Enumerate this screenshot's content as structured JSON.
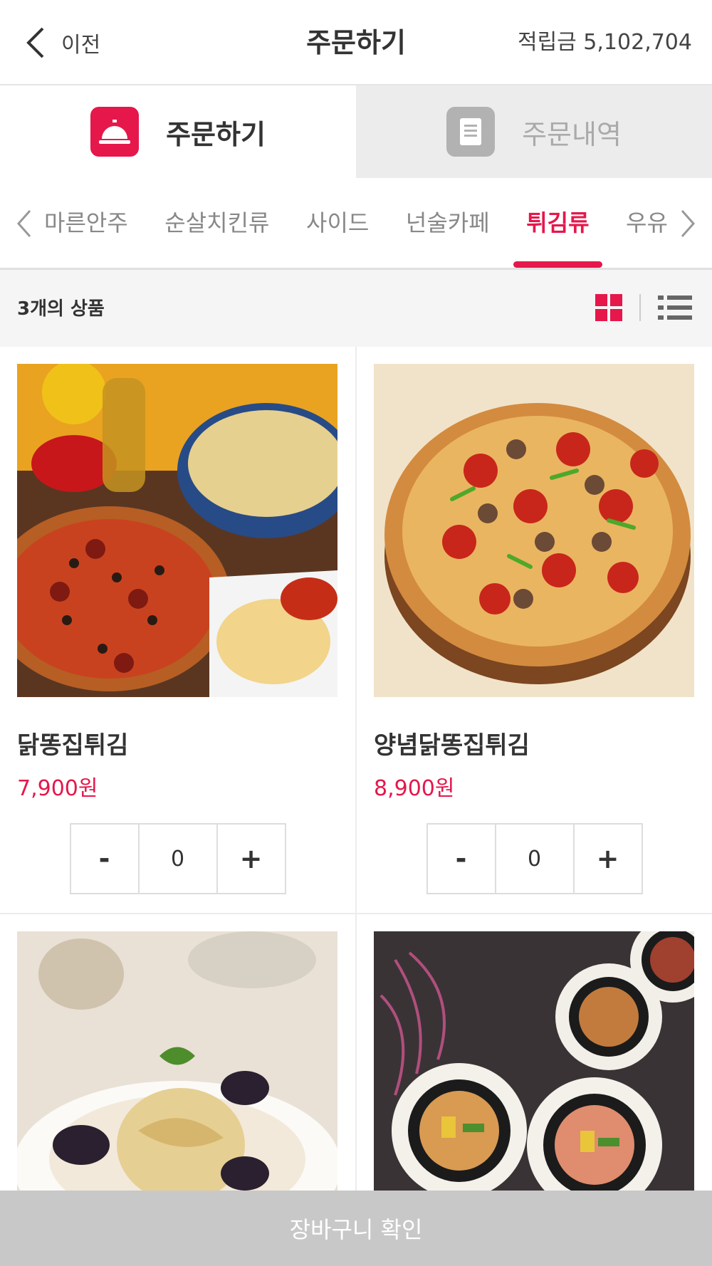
{
  "header": {
    "back_label": "이전",
    "title": "주문하기",
    "points": "적립금 5,102,704"
  },
  "tabs": [
    {
      "label": "주문하기",
      "icon": "service-bell-icon",
      "active": true
    },
    {
      "label": "주문내역",
      "icon": "receipt-icon",
      "active": false
    }
  ],
  "categories": [
    {
      "label": "마른안주",
      "active": false
    },
    {
      "label": "순살치킨류",
      "active": false
    },
    {
      "label": "사이드",
      "active": false
    },
    {
      "label": "넌술카페",
      "active": false
    },
    {
      "label": "튀김류",
      "active": true
    },
    {
      "label": "우유",
      "active": false
    }
  ],
  "list": {
    "count_text": "3개의 상품",
    "view_mode": "grid"
  },
  "products": [
    {
      "name": "닭똥집튀김",
      "price": "7,900원",
      "qty": "0",
      "minus": "-",
      "plus": "+",
      "image": "pizza-pasta-spread"
    },
    {
      "name": "양념닭똥집튀김",
      "price": "8,900원",
      "qty": "0",
      "minus": "-",
      "plus": "+",
      "image": "supreme-pizza"
    },
    {
      "image": "seafood-pasta"
    },
    {
      "image": "kimbap-rolls"
    }
  ],
  "footer": {
    "cart_label": "장바구니 확인"
  },
  "colors": {
    "accent": "#e5174b",
    "inactive_tab": "#ececec",
    "cart_bar": "#c8c8c8"
  }
}
